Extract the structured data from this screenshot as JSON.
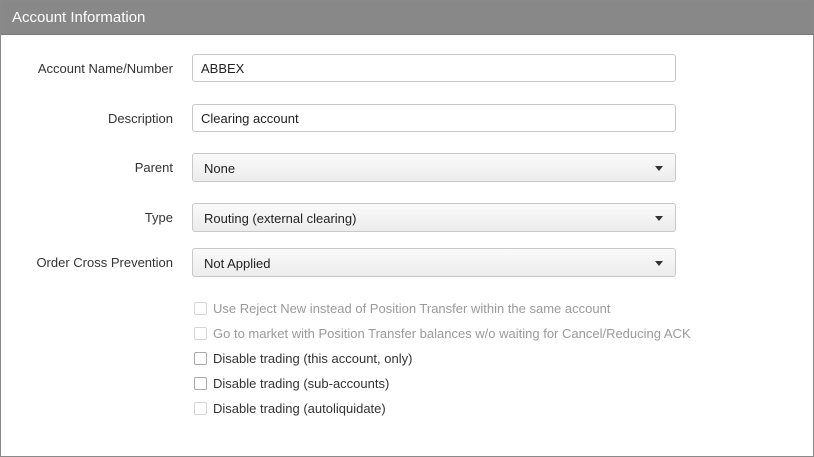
{
  "panel": {
    "title": "Account Information"
  },
  "fields": {
    "account_name": {
      "label": "Account Name/Number",
      "value": "ABBEX"
    },
    "description": {
      "label": "Description",
      "value": "Clearing account"
    },
    "parent": {
      "label": "Parent",
      "value": "None"
    },
    "type": {
      "label": "Type",
      "value": "Routing (external clearing)"
    },
    "order_cross": {
      "label": "Order Cross Prevention",
      "value": "Not Applied"
    }
  },
  "options": [
    {
      "label": "Use Reject New instead of Position Transfer within the same account",
      "enabled": false,
      "checked": false
    },
    {
      "label": "Go to market with Position Transfer balances w/o waiting for Cancel/Reducing ACK",
      "enabled": false,
      "checked": false
    },
    {
      "label": "Disable trading (this account, only)",
      "enabled": true,
      "checked": false
    },
    {
      "label": "Disable trading (sub-accounts)",
      "enabled": true,
      "checked": false
    },
    {
      "label": "Disable trading (autoliquidate)",
      "enabled": false,
      "checked": false
    }
  ]
}
